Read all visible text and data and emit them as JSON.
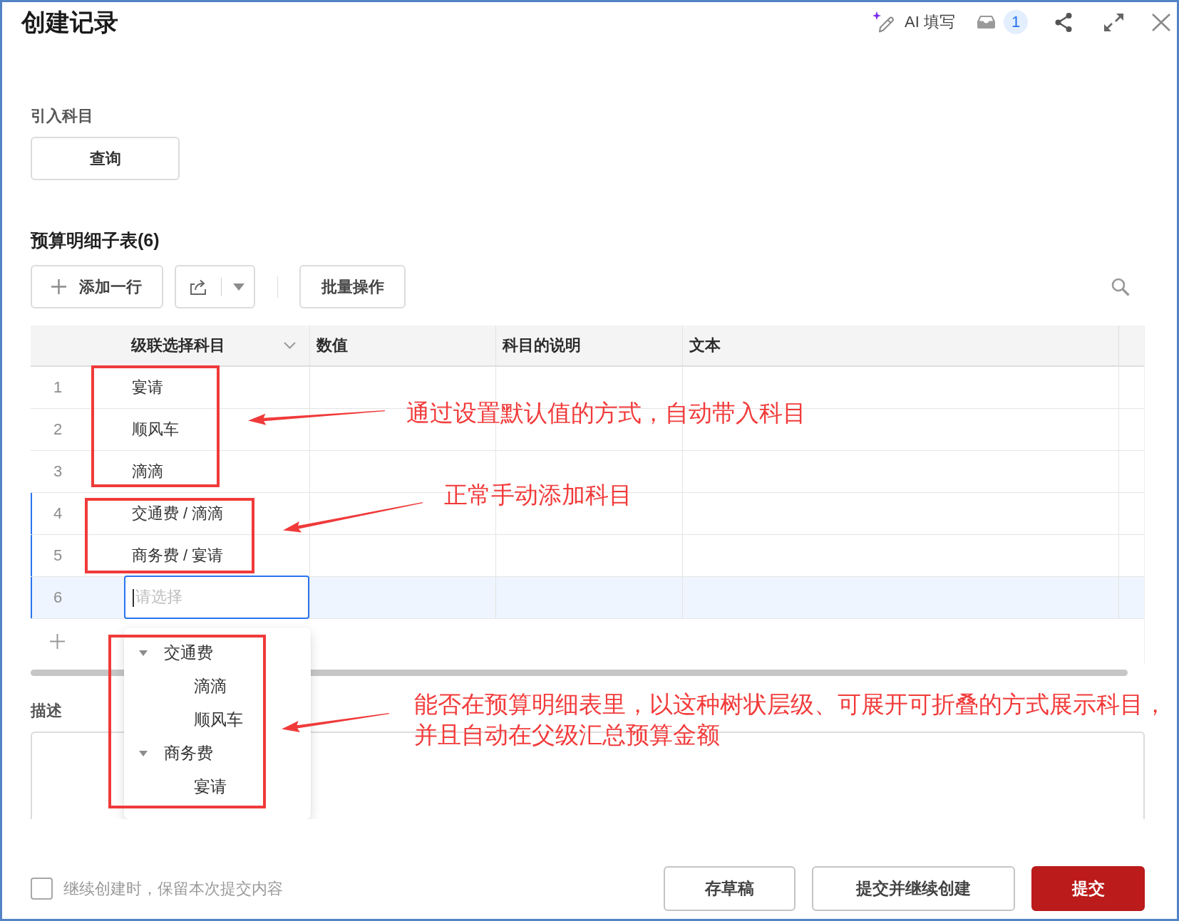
{
  "window": {
    "title": "创建记录",
    "ai_fill": "AI 填写",
    "inbox_count": "1"
  },
  "import_section": {
    "label": "引入科目",
    "button": "查询"
  },
  "subtable": {
    "title": "预算明细子表(6)",
    "add_row": "添加一行",
    "batch": "批量操作",
    "columns": [
      {
        "label": "级联选择科目",
        "kind": "cascader"
      },
      {
        "label": "数值",
        "kind": "text"
      },
      {
        "label": "科目的说明",
        "kind": "text"
      },
      {
        "label": "文本",
        "kind": "text"
      }
    ],
    "rows": [
      {
        "index": "1",
        "kind": "value",
        "subject": "宴请",
        "edited": false,
        "selected": false
      },
      {
        "index": "2",
        "kind": "value",
        "subject": "顺风车",
        "edited": false,
        "selected": false
      },
      {
        "index": "3",
        "kind": "value",
        "subject": "滴滴",
        "edited": false,
        "selected": false
      },
      {
        "index": "4",
        "kind": "value",
        "subject": "交通费 / 滴滴",
        "edited": true,
        "selected": false
      },
      {
        "index": "5",
        "kind": "value",
        "subject": "商务费 / 宴请",
        "edited": true,
        "selected": false
      },
      {
        "index": "6",
        "kind": "input",
        "placeholder": "请选择",
        "edited": true,
        "selected": true
      }
    ]
  },
  "cascader_dropdown": {
    "options": [
      {
        "label": "交通费",
        "expanded": true,
        "children": [
          {
            "label": "滴滴"
          },
          {
            "label": "顺风车"
          }
        ]
      },
      {
        "label": "商务费",
        "expanded": true,
        "children": [
          {
            "label": "宴请"
          }
        ]
      }
    ]
  },
  "description": {
    "label": "描述"
  },
  "footer": {
    "keep_content": {
      "label": "继续创建时，保留本次提交内容",
      "checked": false
    },
    "buttons": [
      {
        "label": "存草稿",
        "kind": "secondary"
      },
      {
        "label": "提交并继续创建",
        "kind": "secondary"
      },
      {
        "label": "提交",
        "kind": "primary"
      }
    ]
  },
  "annotations": [
    {
      "lines": [
        "通过设置默认值的方式，自动带入科目"
      ]
    },
    {
      "lines": [
        "正常手动添加科目"
      ]
    },
    {
      "lines": [
        "能否在预算明细表里，以这种树状层级、可展开可折叠的方式展示科目，",
        "并且自动在父级汇总预算金额"
      ]
    }
  ]
}
